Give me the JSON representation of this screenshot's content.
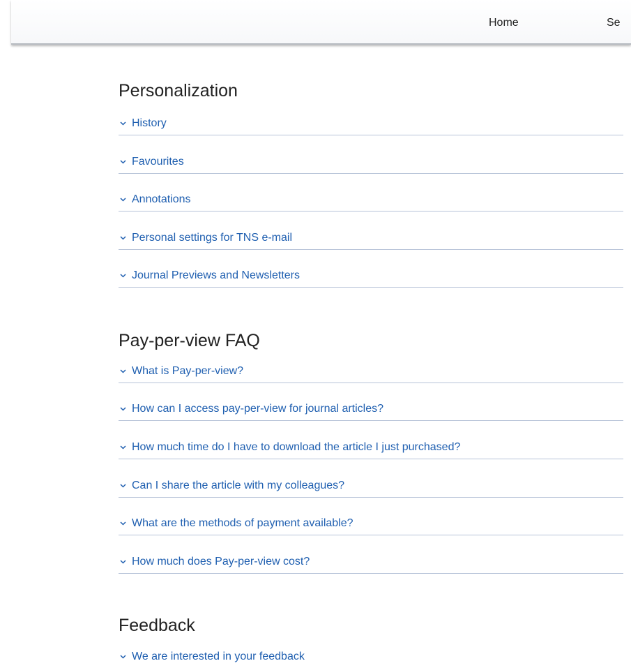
{
  "nav": {
    "home": "Home",
    "search_partial": "Se"
  },
  "sections": [
    {
      "title": "Personalization",
      "items": [
        "History",
        "Favourites",
        "Annotations",
        "Personal settings for TNS e-mail",
        "Journal Previews and Newsletters"
      ]
    },
    {
      "title": "Pay-per-view FAQ",
      "items": [
        "What is Pay-per-view?",
        "How can I access pay-per-view for journal articles?",
        "How much time do I have to download the article I just purchased?",
        "Can I share the article with my colleagues?",
        "What are the methods of payment available?",
        "How much does Pay-per-view cost?"
      ]
    },
    {
      "title": "Feedback",
      "items": [
        "We are interested in your feedback"
      ]
    }
  ],
  "colors": {
    "link": "#1f5fb0",
    "divider": "#b7c3d8",
    "heading": "#222222"
  },
  "icons": {
    "accordion": "chevron-down-icon"
  }
}
